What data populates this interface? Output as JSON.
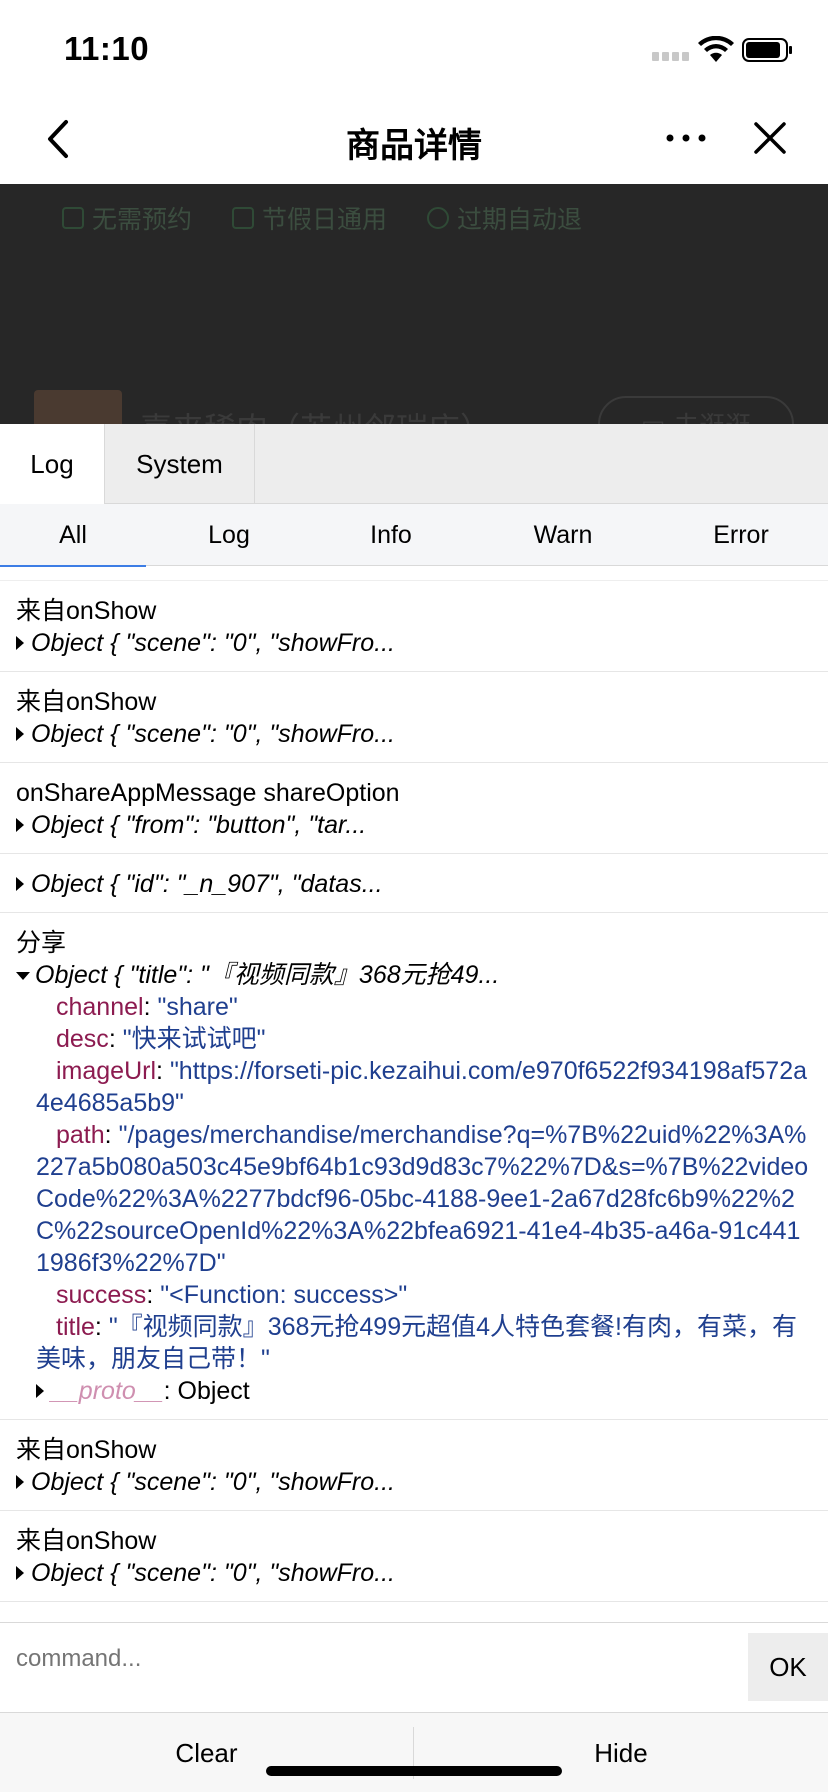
{
  "status_bar": {
    "time": "11:10"
  },
  "nav": {
    "title": "商品详情"
  },
  "page_behind": {
    "tags": [
      "无需预约",
      "节假日通用",
      "过期自动退"
    ],
    "store_name": "喜来稀肉（苏州邻瑞店）",
    "store_button": "去逛逛"
  },
  "console": {
    "top_tabs": [
      "Log",
      "System"
    ],
    "filter_tabs": [
      "All",
      "Log",
      "Info",
      "Warn",
      "Error"
    ],
    "logs": {
      "l1_msg": "来自onShow",
      "l1_obj": "Object { \"scene\": \"0\", \"showFro...",
      "l2_msg": "来自onShow",
      "l2_obj": "Object { \"scene\": \"0\", \"showFro...",
      "l3_msg": "onShareAppMessage shareOption",
      "l3_obj": "Object { \"from\": \"button\", \"tar...",
      "l4_obj": "Object { \"id\": \"_n_907\", \"datas...",
      "l5_msg": "分享",
      "l5_obj": "Object { \"title\": \"『视频同款』368元抢49...",
      "props": [
        {
          "key": "channel",
          "value": "\"share\""
        },
        {
          "key": "desc",
          "value": "\"快来试试吧\""
        },
        {
          "key": "imageUrl",
          "value": "\"https://forseti-pic.kezaihui.com/e970f6522f934198af572a4e4685a5b9\""
        },
        {
          "key": "path",
          "value": "\"/pages/merchandise/merchandise?q=%7B%22uid%22%3A%227a5b080a503c45e9bf64b1c93d9d83c7%22%7D&s=%7B%22videoCode%22%3A%2277bdcf96-05bc-4188-9ee1-2a67d28fc6b9%22%2C%22sourceOpenId%22%3A%22bfea6921-41e4-4b35-a46a-91c4411986f3%22%7D\""
        },
        {
          "key": "success",
          "value": "\"<Function: success>\""
        },
        {
          "key": "title",
          "value": "\"『视频同款』368元抢499元超值4人特色套餐!有肉，有菜，有美味，朋友自己带！\""
        }
      ],
      "proto_key": "__proto__",
      "proto_value": ": Object",
      "l6_msg": "来自onShow",
      "l6_obj": "Object { \"scene\": \"0\", \"showFro...",
      "l7_msg": "来自onShow",
      "l7_obj": "Object { \"scene\": \"0\", \"showFro..."
    },
    "command_placeholder": "command...",
    "ok_label": "OK",
    "clear_label": "Clear",
    "hide_label": "Hide"
  }
}
